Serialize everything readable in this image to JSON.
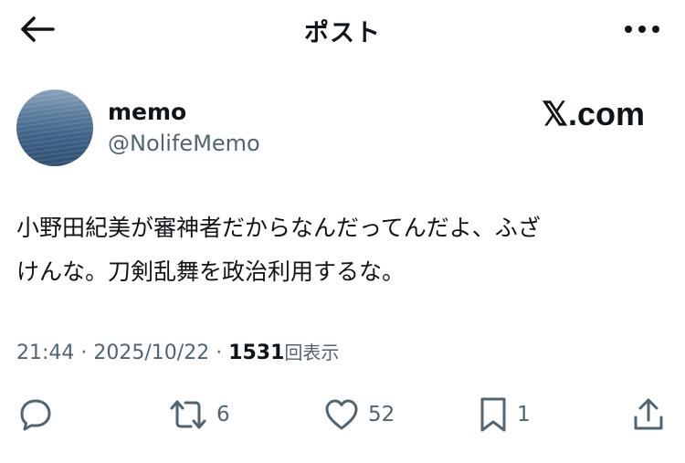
{
  "header": {
    "title": "ポスト",
    "back_icon": "arrow-left-icon",
    "more_icon": "ellipsis-icon"
  },
  "author": {
    "display_name": "memo",
    "handle": "@NolifeMemo"
  },
  "watermark": "𝕏.com",
  "tweet": {
    "text_line1": "小野田紀美が審神者だからなんだってんだよ、ふざ",
    "text_line2": "けんな。刀剣乱舞を政治利用するな。"
  },
  "meta": {
    "time": "21:44",
    "separator": " · ",
    "date": "2025/10/22",
    "views_count": "1531",
    "views_label": "回表示"
  },
  "actions": {
    "reply": {
      "icon": "reply-icon",
      "count": ""
    },
    "repost": {
      "icon": "repost-icon",
      "count": "6"
    },
    "like": {
      "icon": "heart-icon",
      "count": "52"
    },
    "bookmark": {
      "icon": "bookmark-icon",
      "count": "1"
    },
    "share": {
      "icon": "share-icon",
      "count": ""
    }
  },
  "colors": {
    "text_primary": "#0f1419",
    "text_secondary": "#536471",
    "background": "#ffffff"
  }
}
